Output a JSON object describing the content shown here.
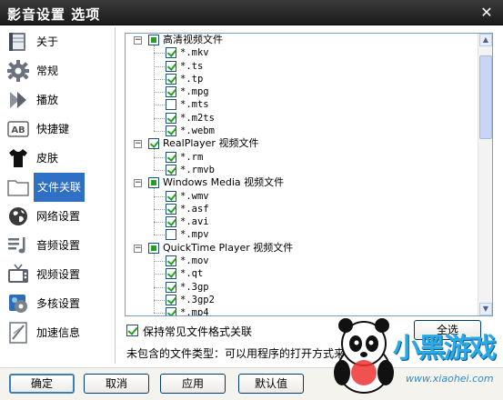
{
  "window": {
    "title": "影音设置 选项",
    "close_glyph": "✕"
  },
  "sidebar": {
    "items": [
      {
        "label": "关于",
        "icon": "book-icon",
        "active": false
      },
      {
        "label": "常规",
        "icon": "gear-icon",
        "active": false
      },
      {
        "label": "播放",
        "icon": "play-arrows-icon",
        "active": false
      },
      {
        "label": "快捷键",
        "icon": "keyboard-ab-icon",
        "active": false
      },
      {
        "label": "皮肤",
        "icon": "tshirt-icon",
        "active": false
      },
      {
        "label": "文件关联",
        "icon": "folder-icon",
        "active": true
      },
      {
        "label": "网络设置",
        "icon": "globe-icon",
        "active": false
      },
      {
        "label": "音频设置",
        "icon": "audio-list-icon",
        "active": false
      },
      {
        "label": "视频设置",
        "icon": "tv-icon",
        "active": false
      },
      {
        "label": "多核设置",
        "icon": "multicore-gear-icon",
        "active": false
      },
      {
        "label": "加速信息",
        "icon": "acceleration-doc-icon",
        "active": false
      }
    ]
  },
  "file_tree": {
    "groups": [
      {
        "name": "高清视频文件",
        "state": "partial",
        "expanded": true,
        "items": [
          {
            "ext": "*.mkv",
            "checked": true
          },
          {
            "ext": "*.ts",
            "checked": true
          },
          {
            "ext": "*.tp",
            "checked": true
          },
          {
            "ext": "*.mpg",
            "checked": true
          },
          {
            "ext": "*.mts",
            "checked": false
          },
          {
            "ext": "*.m2ts",
            "checked": true
          },
          {
            "ext": "*.webm",
            "checked": true
          }
        ]
      },
      {
        "name": "RealPlayer 视频文件",
        "state": "checked",
        "expanded": true,
        "items": [
          {
            "ext": "*.rm",
            "checked": true
          },
          {
            "ext": "*.rmvb",
            "checked": true
          }
        ]
      },
      {
        "name": "Windows Media 视频文件",
        "state": "partial",
        "expanded": true,
        "items": [
          {
            "ext": "*.wmv",
            "checked": true
          },
          {
            "ext": "*.asf",
            "checked": true
          },
          {
            "ext": "*.avi",
            "checked": true
          },
          {
            "ext": "*.mpv",
            "checked": false
          }
        ]
      },
      {
        "name": "QuickTime Player 视频文件",
        "state": "partial",
        "expanded": true,
        "items": [
          {
            "ext": "*.mov",
            "checked": true
          },
          {
            "ext": "*.qt",
            "checked": true
          },
          {
            "ext": "*.3gp",
            "checked": true
          },
          {
            "ext": "*.3gp2",
            "checked": true
          },
          {
            "ext": "*.mp4",
            "checked": true
          }
        ]
      }
    ],
    "scroll": {
      "up_glyph": "▲",
      "down_glyph": "▼"
    }
  },
  "options": {
    "keep_common_label": "保持常见文件格式关联",
    "keep_common_checked": true,
    "select_all_label": "全选",
    "note": "未包含的文件类型：可以用程序的打开方式来..."
  },
  "footer": {
    "ok_label": "确定",
    "cancel_label": "取消",
    "apply_label": "应用",
    "default_label": "默认值"
  },
  "watermark": {
    "brand": "小黑游戏",
    "site": "www.xiaohei.com"
  }
}
